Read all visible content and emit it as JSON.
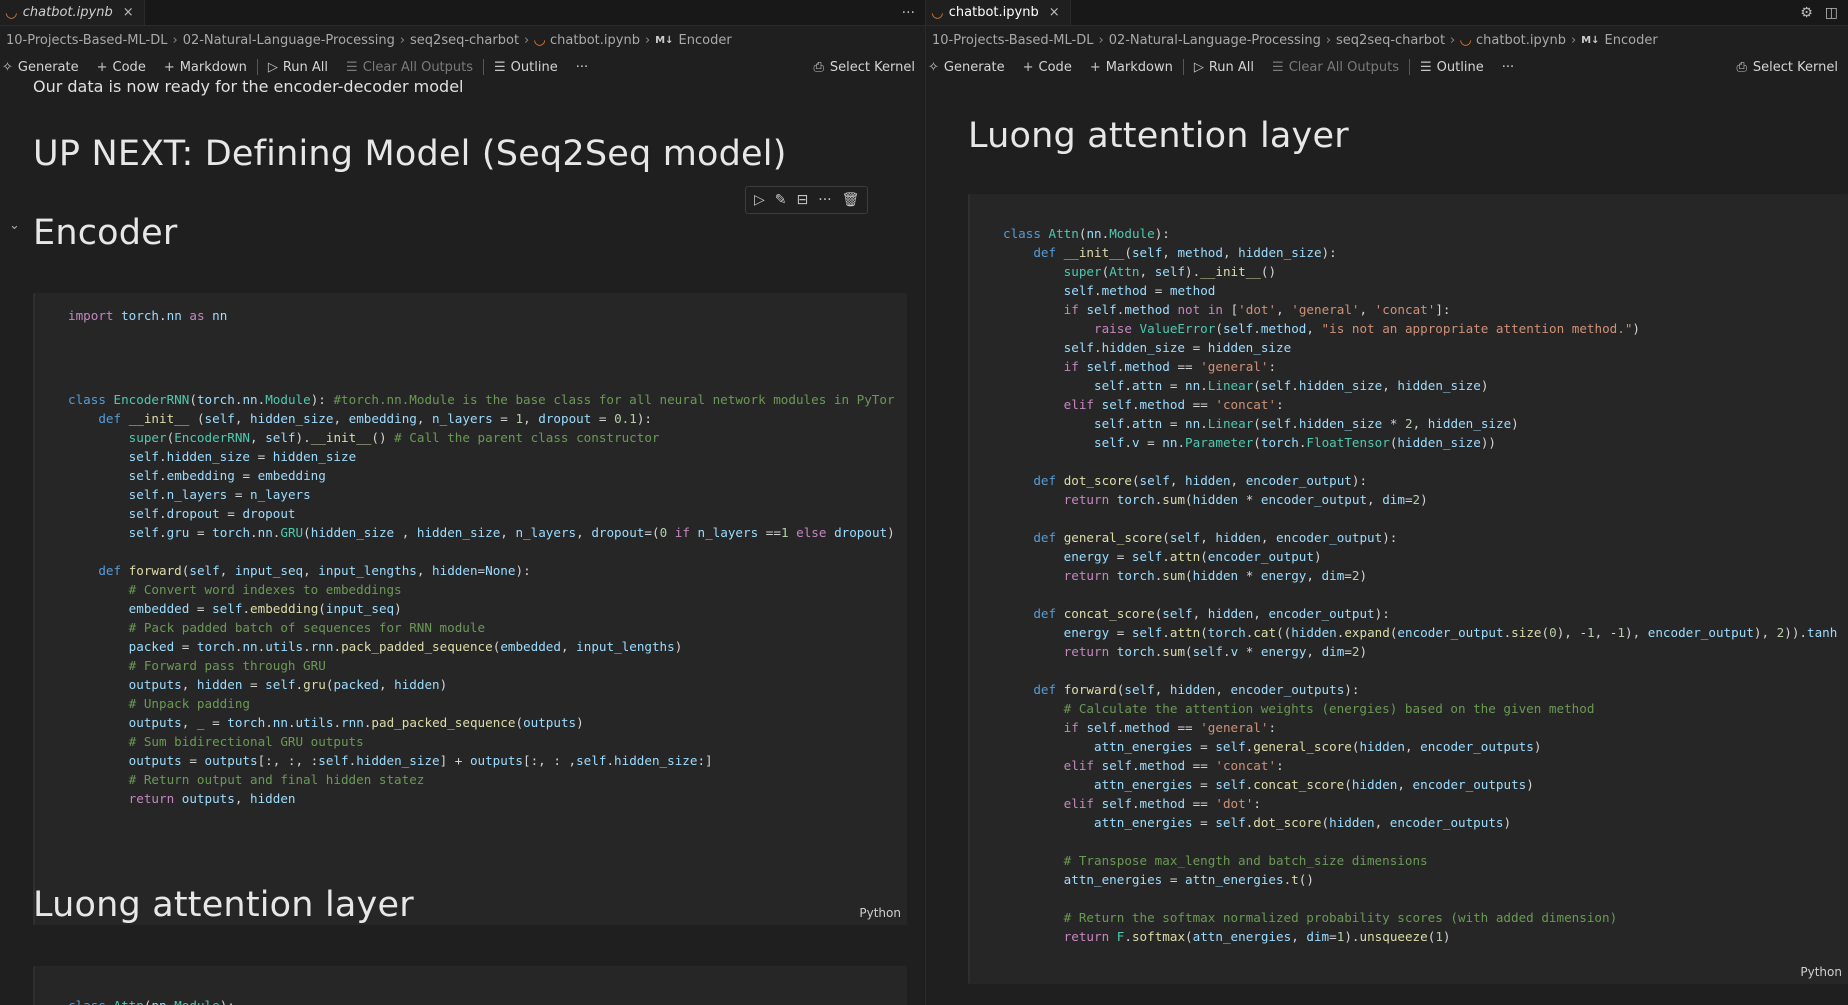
{
  "left": {
    "tab": {
      "label": "chatbot.ipynb",
      "close": "×"
    },
    "more": "···",
    "breadcrumb": [
      "10-Projects-Based-ML-DL",
      "02-Natural-Language-Processing",
      "seq2seq-charbot",
      "chatbot.ipynb",
      "Encoder"
    ],
    "breadcrumb_md_badge": "M↓",
    "toolbar": {
      "generate": "Generate",
      "code": "Code",
      "markdown": "Markdown",
      "run_all": "Run All",
      "clear_outputs": "Clear All Outputs",
      "outline": "Outline",
      "more": "···",
      "select_kernel": "Select Kernel"
    },
    "md_line": "Our data is now ready for the encoder-decoder model",
    "heading_next": "UP NEXT: Defining Model (Seq2Seq model)",
    "heading_encoder": "Encoder",
    "heading_luong": "Luong attention layer",
    "import_code": [
      "import torch.nn as nn"
    ],
    "cell_lang": "Python",
    "encoder_code": [
      "class EncoderRNN(torch.nn.Module): #torch.nn.Module is the base class for all neural network modules in PyTor",
      "    def __init__ (self, hidden_size, embedding, n_layers = 1, dropout = 0.1):",
      "        super(EncoderRNN, self).__init__() # Call the parent class constructor",
      "        self.hidden_size = hidden_size",
      "        self.embedding = embedding",
      "        self.n_layers = n_layers",
      "        self.dropout = dropout",
      "        self.gru = torch.nn.GRU(hidden_size , hidden_size, n_layers, dropout=(0 if n_layers ==1 else dropout)",
      "",
      "    def forward(self, input_seq, input_lengths, hidden=None):",
      "        # Convert word indexes to embeddings",
      "        embedded = self.embedding(input_seq)",
      "        # Pack padded batch of sequences for RNN module",
      "        packed = torch.nn.utils.rnn.pack_padded_sequence(embedded, input_lengths)",
      "        # Forward pass through GRU",
      "        outputs, hidden = self.gru(packed, hidden)",
      "        # Unpack padding",
      "        outputs, _ = torch.nn.utils.rnn.pad_packed_sequence(outputs)",
      "        # Sum bidirectional GRU outputs",
      "        outputs = outputs[:, :, :self.hidden_size] + outputs[:, : ,self.hidden_size:]",
      "        # Return output and final hidden statez",
      "        return outputs, hidden"
    ],
    "attn_code_peek": [
      "class Attn(nn.Module):"
    ]
  },
  "right": {
    "tab": {
      "label": "chatbot.ipynb",
      "close": "×"
    },
    "icons": [
      "gear-icon",
      "split-editor-icon"
    ],
    "breadcrumb": [
      "10-Projects-Based-ML-DL",
      "02-Natural-Language-Processing",
      "seq2seq-charbot",
      "chatbot.ipynb",
      "Encoder"
    ],
    "breadcrumb_md_badge": "M↓",
    "toolbar": {
      "generate": "Generate",
      "code": "Code",
      "markdown": "Markdown",
      "run_all": "Run All",
      "clear_outputs": "Clear All Outputs",
      "outline": "Outline",
      "more": "···",
      "select_kernel": "Select Kernel"
    },
    "heading_luong": "Luong attention layer",
    "cell_lang": "Python",
    "attn_code": [
      "class Attn(nn.Module):",
      "    def __init__(self, method, hidden_size):",
      "        super(Attn, self).__init__()",
      "        self.method = method",
      "        if self.method not in ['dot', 'general', 'concat']:",
      "            raise ValueError(self.method, \"is not an appropriate attention method.\")",
      "        self.hidden_size = hidden_size",
      "        if self.method == 'general':",
      "            self.attn = nn.Linear(self.hidden_size, hidden_size)",
      "        elif self.method == 'concat':",
      "            self.attn = nn.Linear(self.hidden_size * 2, hidden_size)",
      "            self.v = nn.Parameter(torch.FloatTensor(hidden_size))",
      "",
      "    def dot_score(self, hidden, encoder_output):",
      "        return torch.sum(hidden * encoder_output, dim=2)",
      "",
      "    def general_score(self, hidden, encoder_output):",
      "        energy = self.attn(encoder_output)",
      "        return torch.sum(hidden * energy, dim=2)",
      "",
      "    def concat_score(self, hidden, encoder_output):",
      "        energy = self.attn(torch.cat((hidden.expand(encoder_output.size(0), -1, -1), encoder_output), 2)).tanh",
      "        return torch.sum(self.v * energy, dim=2)",
      "",
      "    def forward(self, hidden, encoder_outputs):",
      "        # Calculate the attention weights (energies) based on the given method",
      "        if self.method == 'general':",
      "            attn_energies = self.general_score(hidden, encoder_outputs)",
      "        elif self.method == 'concat':",
      "            attn_energies = self.concat_score(hidden, encoder_outputs)",
      "        elif self.method == 'dot':",
      "            attn_energies = self.dot_score(hidden, encoder_outputs)",
      "",
      "        # Transpose max_length and batch_size dimensions",
      "        attn_energies = attn_energies.t()",
      "",
      "        # Return the softmax normalized probability scores (with added dimension)",
      "        return F.softmax(attn_energies, dim=1).unsqueeze(1)"
    ]
  },
  "colors": {
    "editor_bg": "#1f1f1f",
    "cell_bg": "#262626",
    "keyword": "#c586c0",
    "function": "#dcdcaa",
    "class": "#4ec9b0",
    "variable": "#9cdcfe",
    "string": "#ce9178",
    "number": "#b5cea8",
    "comment": "#6a9955",
    "notebook_icon": "#e37933"
  }
}
